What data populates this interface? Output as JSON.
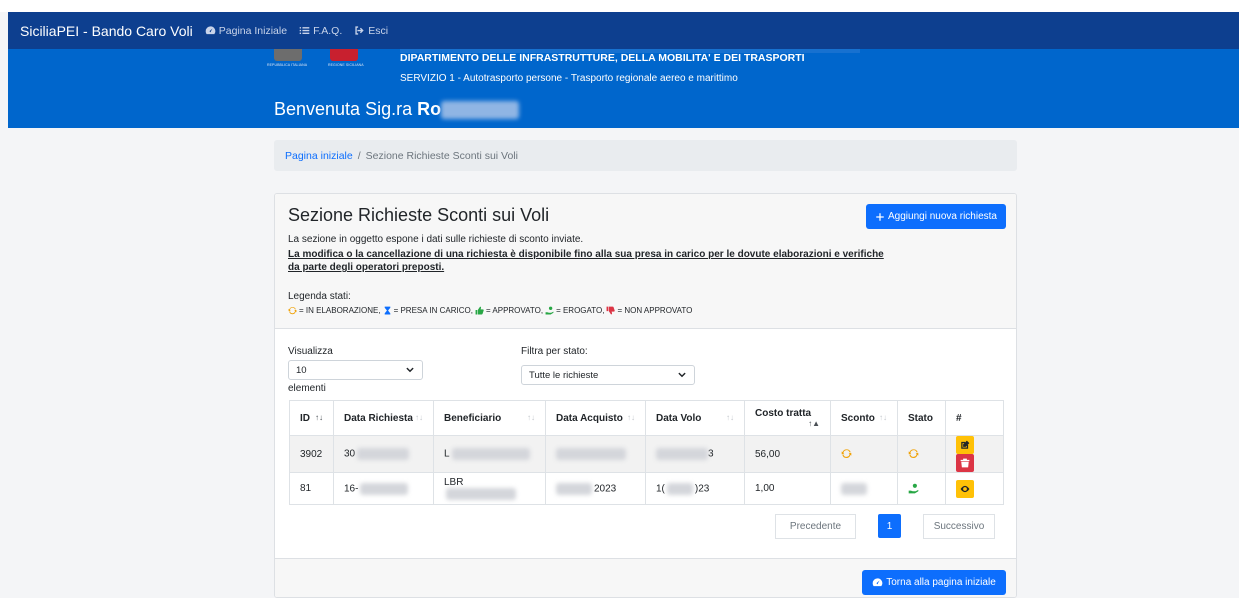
{
  "nav": {
    "brand": "SiciliaPEI - Bando Caro Voli",
    "items": [
      {
        "label": "Pagina Iniziale",
        "icon": "dashboard-icon"
      },
      {
        "label": "F.A.Q.",
        "icon": "list-icon"
      },
      {
        "label": "Esci",
        "icon": "logout-icon"
      }
    ]
  },
  "header": {
    "logo_caption_1": "REPUBBLICA ITALIANA",
    "logo_caption_2": "REGIONE SICILIANA",
    "department": "DIPARTIMENTO DELLE INFRASTRUTTURE, DELLA MOBILITA' E DEI TRASPORTI",
    "service": "SERVIZIO 1 - Autotrasporto persone - Trasporto regionale aereo e marittimo",
    "welcome_prefix": "Benvenuta Sig.ra",
    "welcome_name": "Ro"
  },
  "breadcrumb": {
    "home": "Pagina iniziale",
    "separator": "/",
    "current": "Sezione Richieste Sconti sui Voli"
  },
  "card": {
    "title": "Sezione Richieste Sconti sui Voli",
    "add_button": "Aggiungi nuova richiesta",
    "description": "La sezione in oggetto espone i dati sulle richieste di sconto inviate.",
    "notice": "La modifica o la cancellazione di una richiesta è disponibile fino alla sua presa in carico per le dovute elaborazioni e verifiche da parte degli operatori preposti.",
    "legend_title": "Legenda stati:",
    "legend": [
      {
        "icon": "sync-icon",
        "color": "#f0a30a",
        "text": "= IN ELABORAZIONE,"
      },
      {
        "icon": "hourglass-icon",
        "color": "#0d6efd",
        "text": "= PRESA IN CARICO,"
      },
      {
        "icon": "thumbs-up-icon",
        "color": "#28a745",
        "text": "= APPROVATO,"
      },
      {
        "icon": "hand-coin-icon",
        "color": "#28a745",
        "text": "= EROGATO,"
      },
      {
        "icon": "thumbs-down-icon",
        "color": "#dc3545",
        "text": "= NON APPROVATO"
      }
    ]
  },
  "controls": {
    "show_label": "Visualizza",
    "show_value": "10",
    "show_suffix": "elementi",
    "filter_label": "Filtra per stato:",
    "filter_value": "Tutte le richieste"
  },
  "table": {
    "columns": [
      "ID",
      "Data Richiesta",
      "Beneficiario",
      "Data Acquisto",
      "Data Volo",
      "Costo tratta",
      "Sconto",
      "Stato",
      "#"
    ],
    "rows": [
      {
        "id": "3902",
        "data_richiesta": "30",
        "beneficiario": "L",
        "data_acquisto": "",
        "data_volo": "3",
        "costo": "56,00",
        "sconto_icon": "sync-icon",
        "stato_icon": "sync-icon",
        "actions": [
          "edit-icon",
          "trash-icon"
        ]
      },
      {
        "id": "81",
        "data_richiesta": "16-",
        "beneficiario": "LBR",
        "data_acquisto": "2023",
        "data_volo_a": "1(",
        "data_volo_b": ")23",
        "costo": "1,00",
        "sconto_icon": "",
        "stato_icon": "hand-coin-icon",
        "actions": [
          "eye-icon"
        ]
      }
    ]
  },
  "pagination": {
    "prev": "Precedente",
    "current": "1",
    "next": "Successivo"
  },
  "footer": {
    "home_button": "Torna alla pagina iniziale"
  },
  "colors": {
    "navbar": "#0d3f8f",
    "header": "#0066cc",
    "primary": "#0d6efd",
    "warning": "#ffc107",
    "danger": "#dc3545"
  }
}
